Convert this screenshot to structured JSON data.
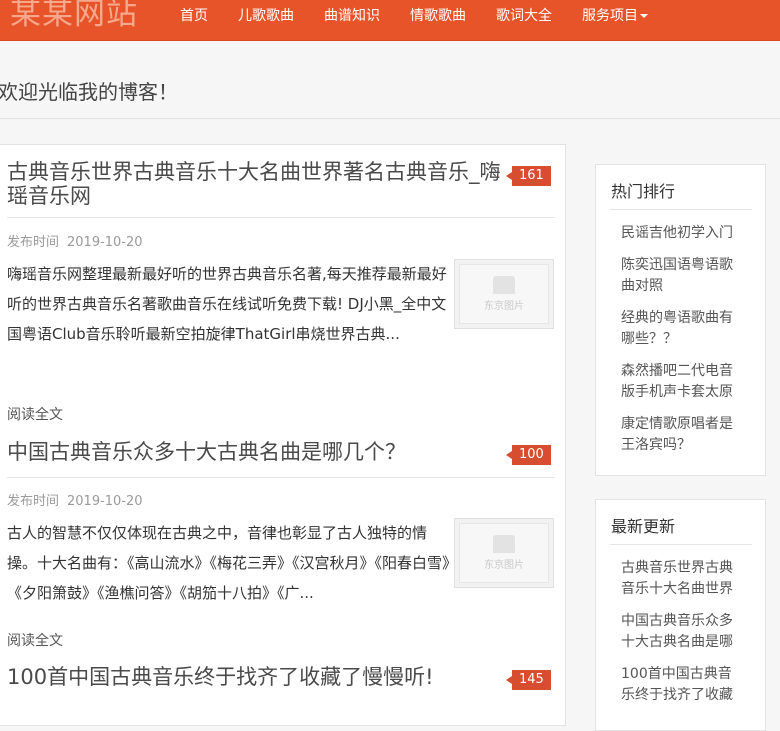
{
  "site": {
    "logo": "某某网站"
  },
  "nav": {
    "items": [
      {
        "label": "首页"
      },
      {
        "label": "儿歌歌曲"
      },
      {
        "label": "曲谱知识"
      },
      {
        "label": "情歌歌曲"
      },
      {
        "label": "歌词大全"
      },
      {
        "label": "服务项目"
      }
    ]
  },
  "welcome": "欢迎光临我的博客！",
  "articles": [
    {
      "title": "古典音乐世界古典音乐十大名曲世界著名古典音乐_嗨瑶音乐网",
      "views": "161",
      "meta_label": "发布时间",
      "date": "2019-10-20",
      "summary": "嗨瑶音乐网整理最新最好听的世界古典音乐名著,每天推荐最新最好听的世界古典音乐名著歌曲音乐在线试听免费下载! DJ小黑_全中文国粤语Club音乐聆听最新空拍旋律ThatGirl串烧世界古典...",
      "read_more": "阅读全文",
      "thumb_label": "东京图片"
    },
    {
      "title": "中国古典音乐众多十大古典名曲是哪几个？",
      "views": "100",
      "meta_label": "发布时间",
      "date": "2019-10-20",
      "summary": "古人的智慧不仅仅体现在古典之中，音律也彰显了古人独特的情操。十大名曲有：《高山流水》《梅花三弄》《汉宫秋月》《阳春白雪》《夕阳箫鼓》《渔樵问答》《胡笳十八拍》《广...",
      "read_more": "阅读全文",
      "thumb_label": "东京图片"
    },
    {
      "title": "100首中国古典音乐终于找齐了收藏了慢慢听!",
      "views": "145"
    }
  ],
  "sidebar": {
    "hot": {
      "title": "热门排行",
      "items": [
        {
          "label": "民谣吉他初学入门"
        },
        {
          "label": "陈奕迅国语粤语歌曲对照"
        },
        {
          "label": "经典的粤语歌曲有哪些？？"
        },
        {
          "label": "森然播吧二代电音版手机声卡套太原"
        },
        {
          "label": "康定情歌原唱者是王洛宾吗？"
        }
      ]
    },
    "latest": {
      "title": "最新更新",
      "items": [
        {
          "label": "古典音乐世界古典音乐十大名曲世界"
        },
        {
          "label": "中国古典音乐众多十大古典名曲是哪"
        },
        {
          "label": "100首中国古典音乐终于找齐了收藏"
        }
      ]
    }
  },
  "colors": {
    "brand": "#e8542a",
    "badge": "#d64d2f"
  }
}
